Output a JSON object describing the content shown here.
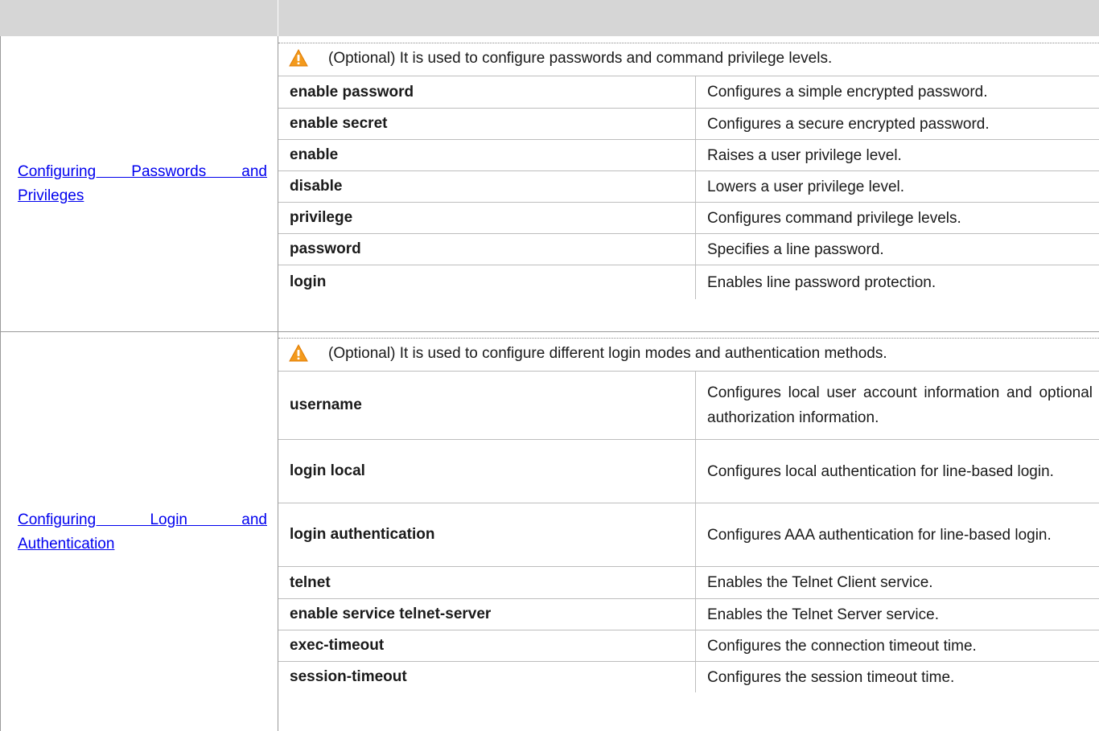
{
  "header": {
    "col1": "",
    "col2": ""
  },
  "sections": [
    {
      "link": "Configuring Passwords and Privileges",
      "note": "(Optional) It is used to configure passwords and command privilege levels.",
      "icon": "warning-triangle-icon",
      "rows": [
        {
          "command": "enable password",
          "description": "Configures a simple encrypted password."
        },
        {
          "command": "enable secret",
          "description": "Configures a secure encrypted password."
        },
        {
          "command": "enable",
          "description": "Raises a user privilege level."
        },
        {
          "command": "disable",
          "description": "Lowers a user privilege level."
        },
        {
          "command": "privilege",
          "description": "Configures command privilege levels."
        },
        {
          "command": "password",
          "description": "Specifies a line password."
        },
        {
          "command": "login",
          "description": "Enables line password protection."
        }
      ]
    },
    {
      "link": "Configuring Login and Authentication",
      "note": "(Optional) It is used to configure different login modes and authentication methods.",
      "icon": "warning-triangle-icon",
      "rows": [
        {
          "command": "username",
          "description": "Configures local user account information and optional authorization information."
        },
        {
          "command": "login local",
          "description": "Configures local authentication for line-based login."
        },
        {
          "command": "login authentication",
          "description": "Configures AAA authentication for line-based login."
        },
        {
          "command": "telnet",
          "description": "Enables the Telnet Client service."
        },
        {
          "command": "enable service telnet-server",
          "description": "Enables the Telnet Server service."
        },
        {
          "command": "exec-timeout",
          "description": "Configures the connection timeout time."
        },
        {
          "command": "session-timeout",
          "description": "Configures the session timeout time."
        }
      ]
    }
  ],
  "colors": {
    "header_bg": "#d6d6d6",
    "link": "#0000ee",
    "warning": "#f39a1d"
  }
}
